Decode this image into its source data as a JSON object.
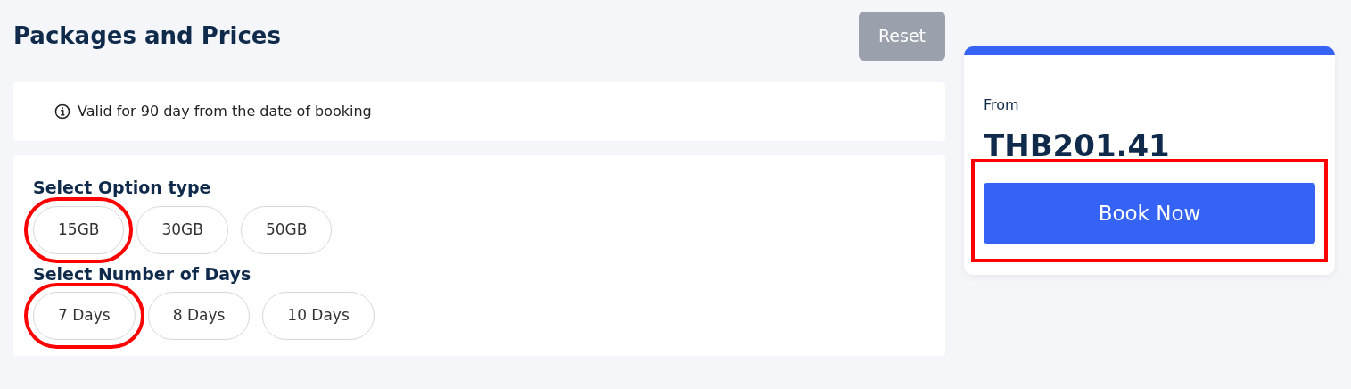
{
  "title": "Packages and Prices",
  "reset_button": {
    "label": "Reset",
    "disabled": true
  },
  "notice": "Valid for 90 day from the date of booking",
  "option_groups": [
    {
      "label": "Select Option type",
      "options": [
        {
          "label": "15GB",
          "highlighted": true
        },
        {
          "label": "30GB",
          "highlighted": false
        },
        {
          "label": "50GB",
          "highlighted": false
        }
      ]
    },
    {
      "label": "Select Number of Days",
      "options": [
        {
          "label": "7 Days",
          "highlighted": true
        },
        {
          "label": "8 Days",
          "highlighted": false
        },
        {
          "label": "10 Days",
          "highlighted": false
        }
      ]
    }
  ],
  "price_card": {
    "from_label": "From",
    "price": "THB201.41",
    "button": {
      "label": "Book Now",
      "highlighted": true
    }
  }
}
